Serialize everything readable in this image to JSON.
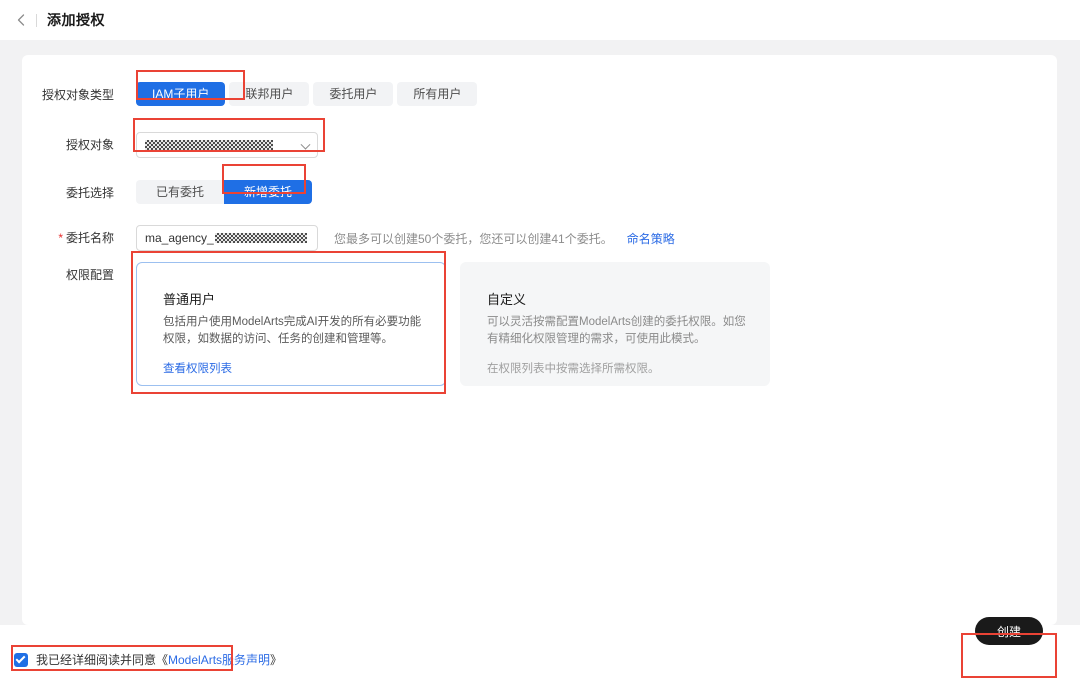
{
  "header": {
    "back_icon": "chevron-left-icon",
    "title": "添加授权"
  },
  "form": {
    "principal_type": {
      "label": "授权对象类型",
      "options": [
        "IAM子用户",
        "联邦用户",
        "委托用户",
        "所有用户"
      ],
      "selected": "IAM子用户"
    },
    "principal": {
      "label": "授权对象",
      "value": "",
      "placeholder": "",
      "icon": "chevron-down-icon"
    },
    "agency_choice": {
      "label": "委托选择",
      "options": [
        "已有委托",
        "新增委托"
      ],
      "selected": "新增委托"
    },
    "agency_name": {
      "label": "委托名称",
      "required_mark": "*",
      "value_prefix": "ma_agency_",
      "hint": "您最多可以创建50个委托，您还可以创建41个委托。",
      "hint_link": "命名策略"
    },
    "permission": {
      "label": "权限配置",
      "cards": [
        {
          "title": "普通用户",
          "desc": "包括用户使用ModelArts完成AI开发的所有必要功能权限，如数据的访问、任务的创建和管理等。",
          "link": "查看权限列表",
          "note": "",
          "selected": true
        },
        {
          "title": "自定义",
          "desc": "可以灵活按需配置ModelArts创建的委托权限。如您有精细化权限管理的需求，可使用此模式。",
          "link": "",
          "note": "在权限列表中按需选择所需权限。",
          "selected": false
        }
      ]
    }
  },
  "footer": {
    "agreement_checked": true,
    "agreement_prefix": "我已经详细阅读并同意《",
    "agreement_link": "ModelArts服务声明",
    "agreement_suffix": "》",
    "create_button": "创建"
  },
  "colors": {
    "accent_blue": "#1f6fe5",
    "link_blue": "#2b6be5",
    "annotation_red": "#ea4335",
    "page_background": "#f2f2f3",
    "panel_background": "#ffffff",
    "button_dark": "#1a1a1a"
  }
}
